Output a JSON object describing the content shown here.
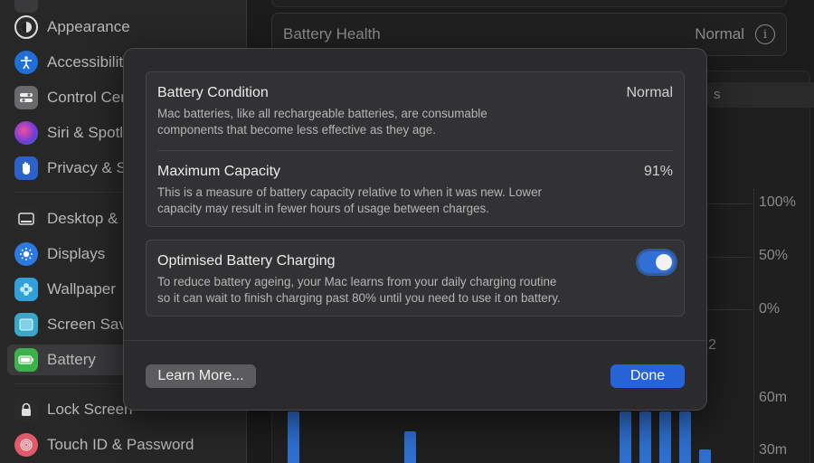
{
  "sidebar": {
    "items": [
      {
        "label": "Appearance",
        "icon": "appearance-icon",
        "color": "#2a2a2a"
      },
      {
        "label": "Accessibility",
        "icon": "accessibility-icon",
        "color": "#1f6fd6"
      },
      {
        "label": "Control Centre",
        "icon": "control-centre-icon",
        "color": "#6a6a6c"
      },
      {
        "label": "Siri & Spotlight",
        "icon": "siri-icon",
        "color": "#b03aa8"
      },
      {
        "label": "Privacy & Security",
        "icon": "privacy-hand-icon",
        "color": "#2c62c8"
      },
      {
        "label": "Desktop & Dock",
        "icon": "desktop-dock-icon",
        "color": "#2a2a2a"
      },
      {
        "label": "Displays",
        "icon": "displays-sun-icon",
        "color": "#2c7ae0"
      },
      {
        "label": "Wallpaper",
        "icon": "wallpaper-flower-icon",
        "color": "#31a0d8"
      },
      {
        "label": "Screen Saver",
        "icon": "screen-saver-icon",
        "color": "#3aa6c9"
      },
      {
        "label": "Battery",
        "icon": "battery-icon",
        "color": "#3cb34a"
      },
      {
        "label": "Lock Screen",
        "icon": "lock-icon",
        "color": "#2a2a2a"
      },
      {
        "label": "Touch ID & Password",
        "icon": "fingerprint-icon",
        "color": "#e05a6a"
      }
    ],
    "selected": "Battery"
  },
  "main": {
    "battery_health_label": "Battery Health",
    "battery_health_value": "Normal",
    "chart_tab_fragment": "s",
    "axis_labels": [
      "100%",
      "50%",
      "0%",
      "60m",
      "30m"
    ],
    "x_tick_fragment": "2"
  },
  "modal": {
    "condition": {
      "title": "Battery Condition",
      "value": "Normal",
      "description_line1": "Mac batteries, like all rechargeable batteries, are consumable",
      "description_line2": "components that become less effective as they age."
    },
    "capacity": {
      "title": "Maximum Capacity",
      "value": "91%",
      "description_line1": "This is a measure of battery capacity relative to when it was new. Lower",
      "description_line2": "capacity may result in fewer hours of usage between charges."
    },
    "optimised": {
      "title": "Optimised Battery Charging",
      "enabled": true,
      "description_line1": "To reduce battery ageing, your Mac learns from your daily charging routine",
      "description_line2": "so it can wait to finish charging past 80% until you need to use it on battery."
    },
    "learn_more_label": "Learn More...",
    "done_label": "Done"
  },
  "colors": {
    "accent": "#2763d8",
    "bar": "#2e6fcf"
  }
}
